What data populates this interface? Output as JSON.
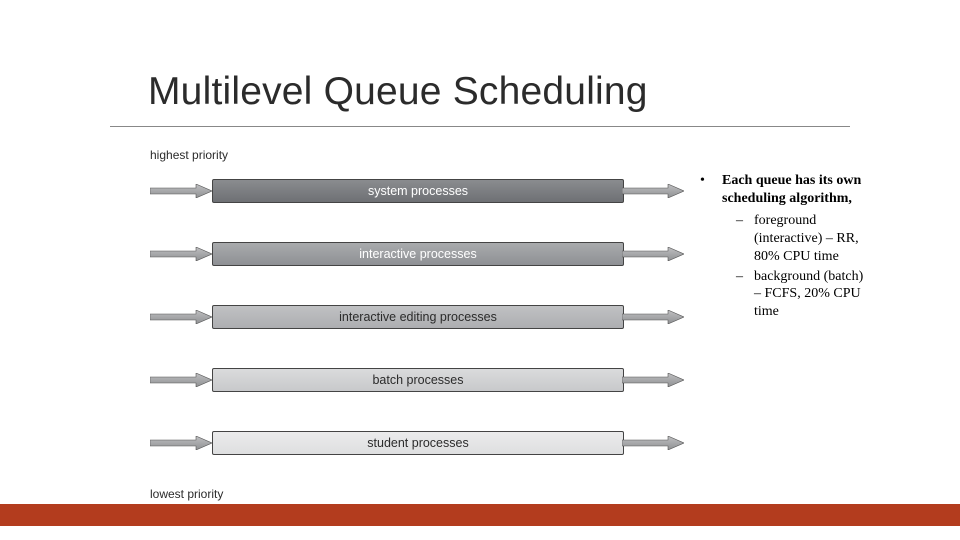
{
  "title": "Multilevel Queue Scheduling",
  "priority": {
    "high": "highest priority",
    "low": "lowest priority"
  },
  "queues": [
    {
      "label": "system processes"
    },
    {
      "label": "interactive processes"
    },
    {
      "label": "interactive editing processes"
    },
    {
      "label": "batch processes"
    },
    {
      "label": "student processes"
    }
  ],
  "notes": {
    "bullet_lead": "Each queue has its own scheduling algorithm,",
    "sub1": "foreground (interactive) – RR, 80% CPU time",
    "sub2": "background (batch) – FCFS, 20% CPU time"
  },
  "colors": {
    "footer": "#b33c1e"
  }
}
